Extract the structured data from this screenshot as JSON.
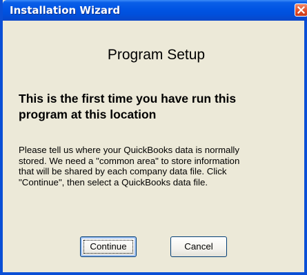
{
  "window": {
    "title": "Installation Wizard",
    "close_icon": "close-icon"
  },
  "main": {
    "heading": "Program Setup",
    "subheading_line1": "This is the first time you have run this",
    "subheading_line2": "program at this location",
    "body_line1": "Please tell us where your QuickBooks data is normally",
    "body_line2": "stored. We need a \"common area\" to store information",
    "body_line3": "that will be shared by each company data file. Click",
    "body_line4": "\"Continue\", then select a QuickBooks data file."
  },
  "buttons": {
    "continue_label": "Continue",
    "cancel_label": "Cancel"
  },
  "colors": {
    "titlebar": "#0054e3",
    "dialog_background": "#ece9d8",
    "close_button": "#e2532d"
  }
}
